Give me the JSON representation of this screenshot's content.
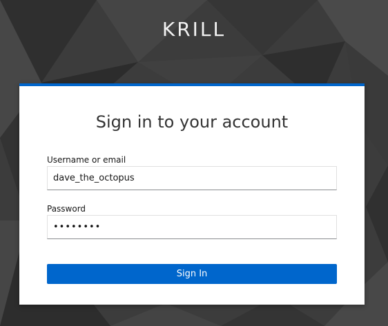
{
  "brand": {
    "title": "KRILL"
  },
  "login": {
    "heading": "Sign in to your account",
    "username_label": "Username or email",
    "username_value": "dave_the_octopus",
    "password_label": "Password",
    "password_value": "••••••••",
    "submit_label": "Sign In"
  },
  "colors": {
    "accent": "#0066cc",
    "background": "#3a3a3a",
    "card": "#ffffff"
  }
}
